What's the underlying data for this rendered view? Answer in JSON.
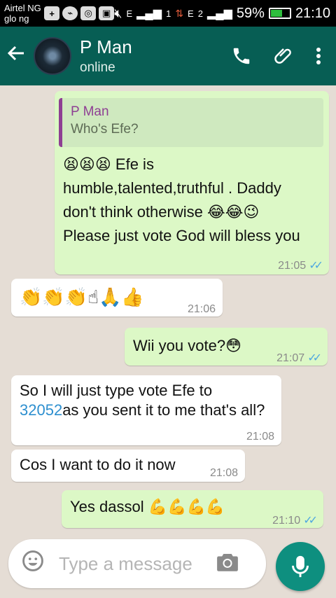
{
  "status_bar": {
    "carrier_1": "Airtel NG",
    "carrier_2": "glo ng",
    "sim1": "1",
    "sim2": "2",
    "net1": "E",
    "net2": "E",
    "battery": "59%",
    "battery_level": 0.59,
    "time": "21:10",
    "icons": [
      "plus-box-icon",
      "messenger-icon",
      "instagram-icon",
      "gallery-icon",
      "mute-icon",
      "signal-icon",
      "data-icon",
      "battery-icon"
    ]
  },
  "header": {
    "contact_name": "P Man",
    "contact_status": "online",
    "icons": [
      "back-arrow-icon",
      "phone-icon",
      "attach-icon",
      "more-icon"
    ]
  },
  "messages": [
    {
      "direction": "outgoing",
      "quote": {
        "name": "P Man",
        "text": "Who's Efe?"
      },
      "text": "😫😫😫 Efe is humble,talented,truthful . Daddy don't think otherwise 😂😂😉 Please just vote God will bless you",
      "time": "21:05",
      "status": "read"
    },
    {
      "direction": "incoming",
      "text": "👏👏👏☝🙏👍",
      "time": "21:06"
    },
    {
      "direction": "outgoing",
      "text": "Wii you vote?😳",
      "time": "21:07",
      "status": "read"
    },
    {
      "direction": "incoming",
      "text_before": "So I will just type vote Efe to ",
      "link": "32052",
      "text_after": "as you sent it to me that's all?",
      "time": "21:08"
    },
    {
      "direction": "incoming",
      "text": "Cos I want to do it now",
      "time": "21:08"
    },
    {
      "direction": "outgoing",
      "text": "Yes dassol 💪💪💪💪",
      "time": "21:10",
      "status": "read"
    }
  ],
  "composer": {
    "placeholder": "Type a message",
    "icons": [
      "emoji-icon",
      "camera-icon",
      "microphone-icon"
    ]
  },
  "colors": {
    "header": "#075e54",
    "outgoing_bubble": "#dcf8c6",
    "incoming_bubble": "#ffffff",
    "chat_background": "#e5ddd5",
    "quote_accent": "#8e3f93",
    "read_ticks": "#4fa8e0",
    "mic_button": "#0e8f7f"
  }
}
